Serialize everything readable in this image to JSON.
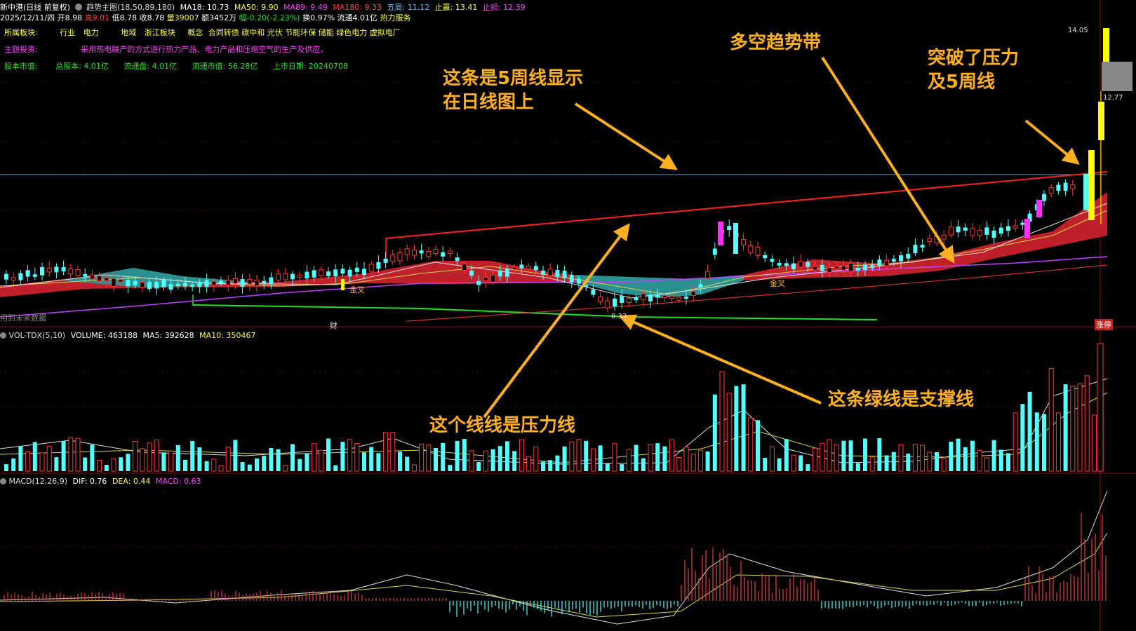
{
  "header": {
    "stock_name": "新中港(日线 前复权)",
    "indicator": "趋势主图(18,50,89,180)",
    "ma18": "MA18: 10.73",
    "ma50": "MA50: 9.90",
    "ma89": "MA89: 9.49",
    "ma180": "MA180: 9.33",
    "wuzhou": "五周: 11.12",
    "zhiying": "止赢: 13.41",
    "zhisun": "止损: 12.39"
  },
  "quote": {
    "date": "2025/12/11/四",
    "open": "开8.98",
    "high": "高9.01",
    "low": "低8.78",
    "close": "收8.78",
    "volume": "量39007",
    "amount": "额3452万",
    "change": "幅-0.20(-2.23%)",
    "turnover": "换0.97%",
    "float": "流通4.01亿",
    "sector": "热力服务"
  },
  "info": {
    "row1_label": "所属板块:",
    "industry_label": "行业",
    "industry": "电力",
    "region_label": "地域",
    "region": "浙江板块",
    "concept_label": "概念",
    "concepts": "合同转债 碳中和 光伏 节能环保 储能 绿色电力 虚拟电厂",
    "row2_label": "主题投资:",
    "row2_text": "采用热电联产的方式进行热力产品、电力产品和压缩空气的生产及供应。",
    "row3_label": "股本市值:",
    "total_shares": "总股本: 4.01亿",
    "float_shares": "流通盘: 4.01亿",
    "float_mcap": "流通市值: 56.28亿",
    "list_date": "上市日期: 20240708"
  },
  "chart_marks": {
    "future_data": "用到未来数据",
    "cai": "财",
    "jincha1": "金叉",
    "jincha2": "金叉",
    "low_label": "8.33",
    "zhangting": "涨停",
    "price_top": "14.05",
    "price_mid": "12.77"
  },
  "volume_pane": {
    "name": "VOL-TDX(5,10)",
    "volume": "VOLUME: 463188",
    "ma5": "MA5: 392628",
    "ma10": "MA10: 350467"
  },
  "macd_pane": {
    "name": "MACD(12,26,9)",
    "dif": "DIF: 0.76",
    "dea": "DEA: 0.44",
    "macd": "MACD: 0.63"
  },
  "annotations": {
    "wuzhou_line_1": "这条是5周线显示",
    "wuzhou_line_2": "在日线图上",
    "trend_band": "多空趋势带",
    "breakout_1": "突破了压力",
    "breakout_2": "及5周线",
    "support": "这条绿线是支撑线",
    "pressure": "这个线线是压力线"
  },
  "colors": {
    "up": "#ff3a3a",
    "down": "#54ffff",
    "annotation": "#ffb020",
    "pressure_line": "#ff2020",
    "support_line": "#20e020",
    "wuzhou_line": "#5fa0c0"
  }
}
